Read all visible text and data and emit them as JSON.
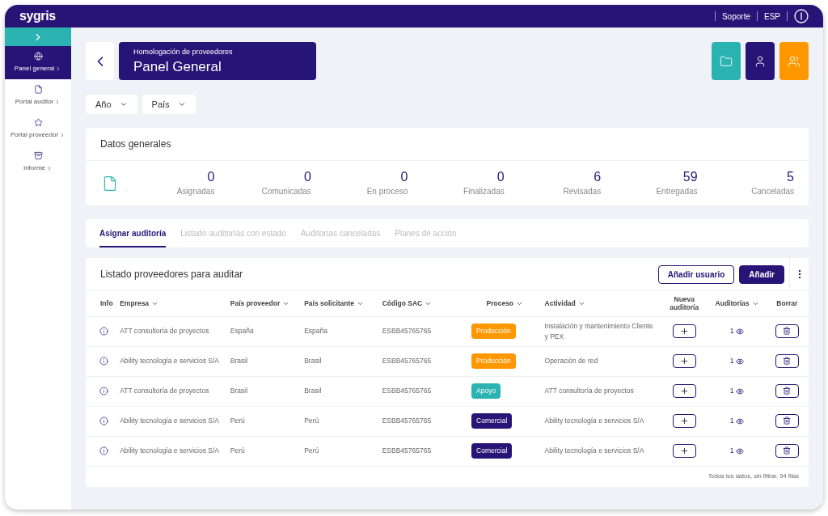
{
  "header": {
    "logo": "sygris",
    "links": [
      "Soporte",
      "ESP"
    ]
  },
  "sidebar": {
    "items": [
      {
        "label": "Panel general",
        "selected": true
      },
      {
        "label": "Portal auditor",
        "selected": false
      },
      {
        "label": "Portal proveedor",
        "selected": false
      },
      {
        "label": "Informe",
        "selected": false
      }
    ]
  },
  "title_block": {
    "subtitle": "Homologación de proveedores",
    "title": "Panel General"
  },
  "filters": [
    "Año",
    "País"
  ],
  "summary": {
    "title": "Datos generales",
    "stats": [
      {
        "value": "0",
        "label": "Asignadas"
      },
      {
        "value": "0",
        "label": "Comunicadas"
      },
      {
        "value": "0",
        "label": "En proceso"
      },
      {
        "value": "0",
        "label": "Finalizadas"
      },
      {
        "value": "6",
        "label": "Revisadas"
      },
      {
        "value": "59",
        "label": "Entregadas"
      },
      {
        "value": "5",
        "label": "Canceladas"
      }
    ]
  },
  "tabs": [
    {
      "label": "Asignar auditoría",
      "selected": true
    },
    {
      "label": "Listado auditorías con estado",
      "selected": false
    },
    {
      "label": "Auditorías canceladas",
      "selected": false
    },
    {
      "label": "Planes de acción",
      "selected": false
    }
  ],
  "table": {
    "title": "Listado proveedores para auditar",
    "buttons": [
      {
        "label": "Añadir usuario",
        "kind": "outline"
      },
      {
        "label": "Añadir",
        "kind": "solid"
      }
    ],
    "columns": [
      {
        "label": "Info",
        "sortable": false
      },
      {
        "label": "Empresa",
        "sortable": true
      },
      {
        "label": "País proveedor",
        "sortable": true
      },
      {
        "label": "País solicitante",
        "sortable": true
      },
      {
        "label": "Código SAC",
        "sortable": true
      },
      {
        "label": "Proceso",
        "sortable": true
      },
      {
        "label": "Actividad",
        "sortable": true
      },
      {
        "label": "Nueva auditoría",
        "sortable": false
      },
      {
        "label": "Auditorías",
        "sortable": true
      },
      {
        "label": "Borrar",
        "sortable": false
      }
    ],
    "rows": [
      {
        "empresa": "ATT consultoría de proyectos",
        "pais_proveedor": "España",
        "pais_solicitante": "España",
        "codigo_sac": "ESBB45765765",
        "proceso": {
          "label": "Producción",
          "color": "#ff9800"
        },
        "actividad": "Instalación y mantenimiento Cliente y PEX",
        "auditorias": "1"
      },
      {
        "empresa": "Ability tecnología e servicios S/A",
        "pais_proveedor": "Brasil",
        "pais_solicitante": "Brasil",
        "codigo_sac": "ESBB45765765",
        "proceso": {
          "label": "Producción",
          "color": "#ff9800"
        },
        "actividad": "Operación de red",
        "auditorias": "1"
      },
      {
        "empresa": "ATT consultoría de proyectos",
        "pais_proveedor": "Brasil",
        "pais_solicitante": "Brasil",
        "codigo_sac": "ESBB45765765",
        "proceso": {
          "label": "Apoyo",
          "color": "#2bb3b1"
        },
        "actividad": "ATT consultoría de proyectos",
        "auditorias": "1"
      },
      {
        "empresa": "Ability tecnología e servicios S/A",
        "pais_proveedor": "Perú",
        "pais_solicitante": "Perú",
        "codigo_sac": "ESBB45765765",
        "proceso": {
          "label": "Comercial",
          "color": "#261577"
        },
        "actividad": "Ability tecnología e servicios S/A",
        "auditorias": "1"
      },
      {
        "empresa": "Ability tecnología e servicios S/A",
        "pais_proveedor": "Perú",
        "pais_solicitante": "Perú",
        "codigo_sac": "ESBB45765765",
        "proceso": {
          "label": "Comercial",
          "color": "#261577"
        },
        "actividad": "Ability tecnología e servicios S/A",
        "auditorias": "1"
      }
    ],
    "footer": "Todos los datos, sin filtrar. 94 filas"
  }
}
